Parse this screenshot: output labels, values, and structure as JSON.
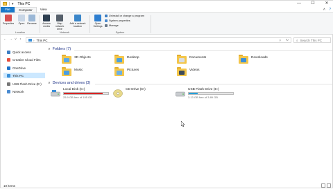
{
  "titlebar": {
    "title": "This PC",
    "arrow": "▾",
    "buttons": {
      "minimize": "—",
      "maximize": "☐",
      "close": "✕"
    }
  },
  "tabs": [
    {
      "label": "File"
    },
    {
      "label": "Computer"
    },
    {
      "label": "View"
    }
  ],
  "tabs_right": {
    "collapse": "˄",
    "help": "?"
  },
  "ribbon": {
    "buttons": [
      {
        "label": "Properties",
        "color": "#d94f4f"
      },
      {
        "label": "Open",
        "color": "#c8d6e6"
      },
      {
        "label": "Rename",
        "color": "#9ab7d6"
      },
      {
        "label": "Access media",
        "color": "#2d3e50"
      },
      {
        "label": "Map network drive",
        "color": "#56606b"
      },
      {
        "label": "Add a network location",
        "color": "#3b86c9"
      },
      {
        "label": "Open Settings",
        "color": "#2f7fd0"
      }
    ],
    "system_items": [
      {
        "label": "Uninstall or change a program",
        "color": "#3c7ec4"
      },
      {
        "label": "System properties",
        "color": "#4a8bd1"
      },
      {
        "label": "Manage",
        "color": "#6b7a8a"
      }
    ],
    "groups": {
      "location": "Location",
      "network": "Network",
      "system": "System"
    }
  },
  "address": {
    "back": "←",
    "forward": "→",
    "recent": "˅",
    "up": "↑",
    "path_sep": "›",
    "path": "This PC",
    "dropdown": "˅",
    "refresh": "↻",
    "search_placeholder": "Search This PC",
    "search_glyph": "⌕"
  },
  "nav": [
    {
      "label": "Quick access",
      "color": "#3c7ec4",
      "selected": false
    },
    {
      "label": "Creative Cloud Files",
      "color": "#e64e3d",
      "selected": false
    },
    {
      "label": "OneDrive",
      "color": "#1e73c9",
      "selected": false
    },
    {
      "label": "This PC",
      "color": "#3a8fd8",
      "selected": true
    },
    {
      "label": "USB Flash Drive (E:)",
      "color": "#777777",
      "selected": false
    },
    {
      "label": "Network",
      "color": "#4a8bd1",
      "selected": false
    }
  ],
  "folders_section": {
    "chev": "∨",
    "label": "Folders (7)"
  },
  "folders": [
    {
      "label": "3D Objects",
      "badge": "#5aa9e6"
    },
    {
      "label": "Desktop",
      "badge": "#4aa0e0"
    },
    {
      "label": "Documents",
      "badge": "#d8dde3"
    },
    {
      "label": "Downloads",
      "badge": "#3c8fd9"
    },
    {
      "label": "Music",
      "badge": "#4a9ee2"
    },
    {
      "label": "Pictures",
      "badge": "#6ab0e8"
    },
    {
      "label": "Videos",
      "badge": "#3e4b58"
    }
  ],
  "drives_section": {
    "chev": "∨",
    "label": "Devices and drives (3)"
  },
  "drives": [
    {
      "label": "Local Disk (C:)",
      "free": "25.9 GB free of 195 GB",
      "used_fraction": 0.87,
      "bar_color": "#da2626",
      "show_bar": true
    },
    {
      "label": "CD Drive (D:)",
      "free": "",
      "used_fraction": 0,
      "bar_color": "#26a0da",
      "show_bar": false
    },
    {
      "label": "USB Flash Drive (E:)",
      "free": "3.13 GB free of 3.89 GB",
      "used_fraction": 0.2,
      "bar_color": "#26a0da",
      "show_bar": true
    }
  ],
  "status": {
    "items": "10 items"
  }
}
